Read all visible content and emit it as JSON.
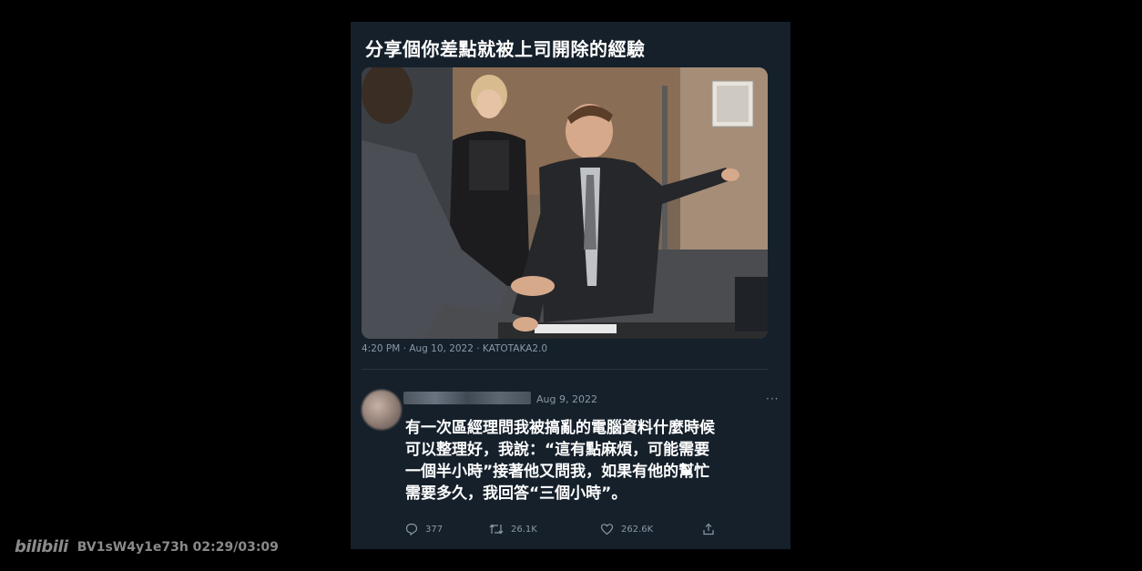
{
  "post": {
    "title": "分享個你差點就被上司開除的經驗",
    "meta": "4:20 PM · Aug 10, 2022 · KATOTAKA2.0"
  },
  "reply": {
    "date": "Aug 9, 2022",
    "more": "···",
    "lines": [
      "有一次區經理問我被搞亂的電腦資料什麼時候",
      "可以整理好，我說：“這有點麻煩，可能需要",
      "一個半小時”接著他又問我，如果有他的幫忙",
      "需要多久，我回答“三個小時”。"
    ],
    "stats": {
      "replies": "377",
      "retweets": "26.1K",
      "likes": "262.6K"
    }
  },
  "colors": {
    "card_bg": "#15202b",
    "muted": "#8b98a5",
    "background": "#000000"
  },
  "watermark": {
    "logo": "bilibili",
    "video_info": "BV1sW4y1e73h 02:29/03:09"
  }
}
